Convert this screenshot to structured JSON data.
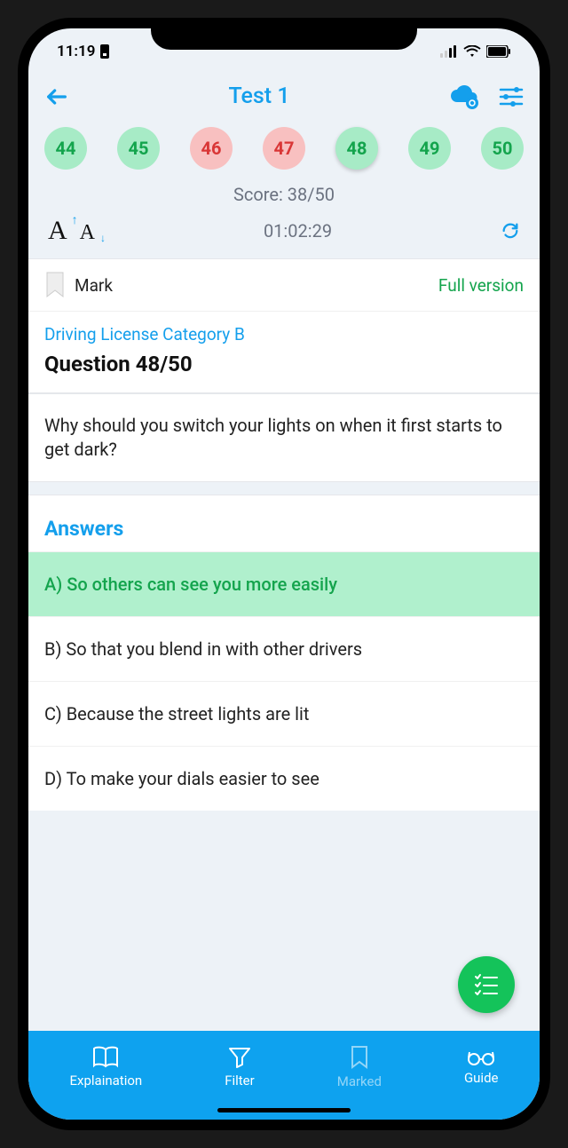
{
  "status": {
    "time": "11:19"
  },
  "header": {
    "title": "Test 1"
  },
  "qnav": [
    {
      "n": "44",
      "state": "correct"
    },
    {
      "n": "45",
      "state": "correct"
    },
    {
      "n": "46",
      "state": "wrong"
    },
    {
      "n": "47",
      "state": "wrong"
    },
    {
      "n": "48",
      "state": "current"
    },
    {
      "n": "49",
      "state": "correct"
    },
    {
      "n": "50",
      "state": "correct"
    }
  ],
  "score": "Score: 38/50",
  "timer": "01:02:29",
  "mark": {
    "label": "Mark"
  },
  "full_version": "Full version",
  "category": "Driving License Category B",
  "question_title": "Question 48/50",
  "question_text": "Why should you switch your lights on when it first starts to get dark?",
  "answers_header": "Answers",
  "answers": [
    {
      "text": "A) So others can see you more easily",
      "correct": true
    },
    {
      "text": "B) So that you blend in with other drivers",
      "correct": false
    },
    {
      "text": "C) Because the street lights are lit",
      "correct": false
    },
    {
      "text": "D) To make your dials easier to see",
      "correct": false
    }
  ],
  "nav": {
    "explaination": "Explaination",
    "filter": "Filter",
    "marked": "Marked",
    "guide": "Guide"
  }
}
